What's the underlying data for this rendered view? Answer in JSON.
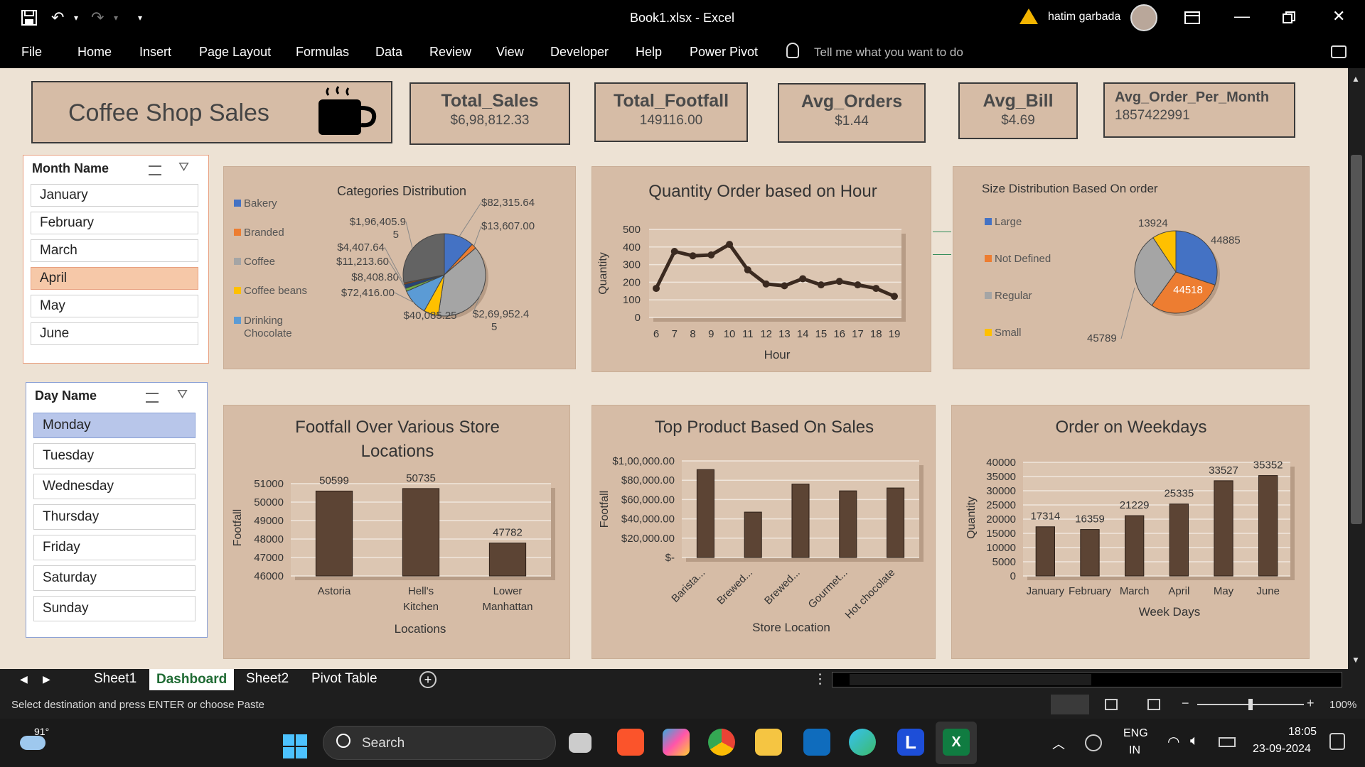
{
  "window": {
    "title": "Book1.xlsx - Excel",
    "user": "hatim garbada"
  },
  "menu": [
    "File",
    "Home",
    "Insert",
    "Page Layout",
    "Formulas",
    "Data",
    "Review",
    "View",
    "Developer",
    "Help",
    "Power Pivot"
  ],
  "tell_me": "Tell me what you want to do",
  "dashboard": {
    "title": "Coffee Shop Sales"
  },
  "kpis": [
    {
      "label": "Total_Sales",
      "value": "$6,98,812.33"
    },
    {
      "label": "Total_Footfall",
      "value": "149116.00"
    },
    {
      "label": "Avg_Orders",
      "value": "$1.44"
    },
    {
      "label": "Avg_Bill",
      "value": "$4.69"
    },
    {
      "label": "Avg_Order_Per_Month",
      "value": "1857422991"
    }
  ],
  "month_slicer": {
    "title": "Month Name",
    "items": [
      "January",
      "February",
      "March",
      "April",
      "May",
      "June"
    ],
    "selected": "April"
  },
  "day_slicer": {
    "title": "Day Name",
    "items": [
      "Monday",
      "Tuesday",
      "Wednesday",
      "Thursday",
      "Friday",
      "Saturday",
      "Sunday"
    ],
    "selected": "Monday"
  },
  "chart_data": [
    {
      "type": "pie",
      "title": "Categories Distribution",
      "legend": [
        "Bakery",
        "Branded",
        "Coffee",
        "Coffee beans",
        "Drinking Chocolate"
      ],
      "data_labels": [
        "$82,315.64",
        "$13,607.00",
        "$2,69,952.45",
        "$40,085.25",
        "$72,416.00",
        "$8,408.80",
        "$11,213.60",
        "$4,407.64",
        "$1,96,405.95"
      ],
      "slices": [
        {
          "value": 82315.64,
          "color": "#4472c4"
        },
        {
          "value": 13607.0,
          "color": "#ed7d31"
        },
        {
          "value": 269952.45,
          "color": "#a5a5a5"
        },
        {
          "value": 40085.25,
          "color": "#ffc000"
        },
        {
          "value": 72416.0,
          "color": "#5b9bd5"
        },
        {
          "value": 8408.8,
          "color": "#70ad47"
        },
        {
          "value": 11213.6,
          "color": "#264478"
        },
        {
          "value": 4407.64,
          "color": "#9e480e"
        },
        {
          "value": 196405.95,
          "color": "#636363"
        }
      ]
    },
    {
      "type": "line",
      "title": "Quantity Order based on Hour",
      "xlabel": "Hour",
      "ylabel": "Quantity",
      "x": [
        6,
        7,
        8,
        9,
        10,
        11,
        12,
        13,
        14,
        15,
        16,
        17,
        18,
        19
      ],
      "values": [
        165,
        375,
        350,
        355,
        415,
        270,
        190,
        180,
        220,
        185,
        205,
        185,
        165,
        120
      ],
      "ylim": [
        0,
        500
      ],
      "yticks": [
        0,
        100,
        200,
        300,
        400,
        500
      ]
    },
    {
      "type": "pie",
      "title": "Size Distribution  Based  On order",
      "legend": [
        "Large",
        "Not Defined",
        "Regular",
        "Small"
      ],
      "slices": [
        {
          "label": "Large",
          "value": 44885,
          "color": "#4472c4"
        },
        {
          "label": "Not Defined",
          "value": 44518,
          "color": "#ed7d31"
        },
        {
          "label": "Regular",
          "value": 45789,
          "color": "#a5a5a5"
        },
        {
          "label": "Small",
          "value": 13924,
          "color": "#ffc000"
        }
      ]
    },
    {
      "type": "bar",
      "title": "Footfall Over  Various Store Locations",
      "xlabel": "Locations",
      "ylabel": "Footfall",
      "categories": [
        "Astoria",
        "Hell's Kitchen",
        "Lower Manhattan"
      ],
      "values": [
        50599,
        50735,
        47782
      ],
      "ylim": [
        46000,
        51000
      ],
      "yticks": [
        "46000",
        "47000",
        "48000",
        "49000",
        "50000",
        "51000"
      ]
    },
    {
      "type": "bar",
      "title": "Top Product Based On Sales",
      "xlabel": "Store Location",
      "ylabel": "Footfall",
      "categories": [
        "Barista...",
        "Brewed...",
        "Brewed...",
        "Gourmet...",
        "Hot chocolate"
      ],
      "values": [
        91000,
        47000,
        76000,
        69000,
        72000
      ],
      "ylim": [
        0,
        100000
      ],
      "yticks": [
        "$-",
        "$20,000.00",
        "$40,000.00",
        "$60,000.00",
        "$80,000.00",
        "$1,00,000.00"
      ]
    },
    {
      "type": "bar",
      "title": "Order on Weekdays",
      "xlabel": "Week Days",
      "ylabel": "Quantity",
      "categories": [
        "January",
        "February",
        "March",
        "April",
        "May",
        "June"
      ],
      "values": [
        17314,
        16359,
        21229,
        25335,
        33527,
        35352
      ],
      "ylim": [
        0,
        40000
      ],
      "yticks": [
        "0",
        "5000",
        "10000",
        "15000",
        "20000",
        "25000",
        "30000",
        "35000",
        "40000"
      ]
    }
  ],
  "sheet_tabs": [
    "Sheet1",
    "Dashboard",
    "Sheet2",
    "Pivot Table"
  ],
  "active_tab": "Dashboard",
  "status": {
    "message": "Select destination and press ENTER or choose Paste",
    "zoom": "100%"
  },
  "taskbar": {
    "weather": "91°",
    "search": "Search",
    "lang1": "ENG",
    "lang2": "IN",
    "time": "18:05",
    "date": "23-09-2024"
  },
  "colors": {
    "bar": "#5c4434",
    "panel": "#d6bca6",
    "sheet": "#ede2d4",
    "line": "#3b2a20"
  }
}
